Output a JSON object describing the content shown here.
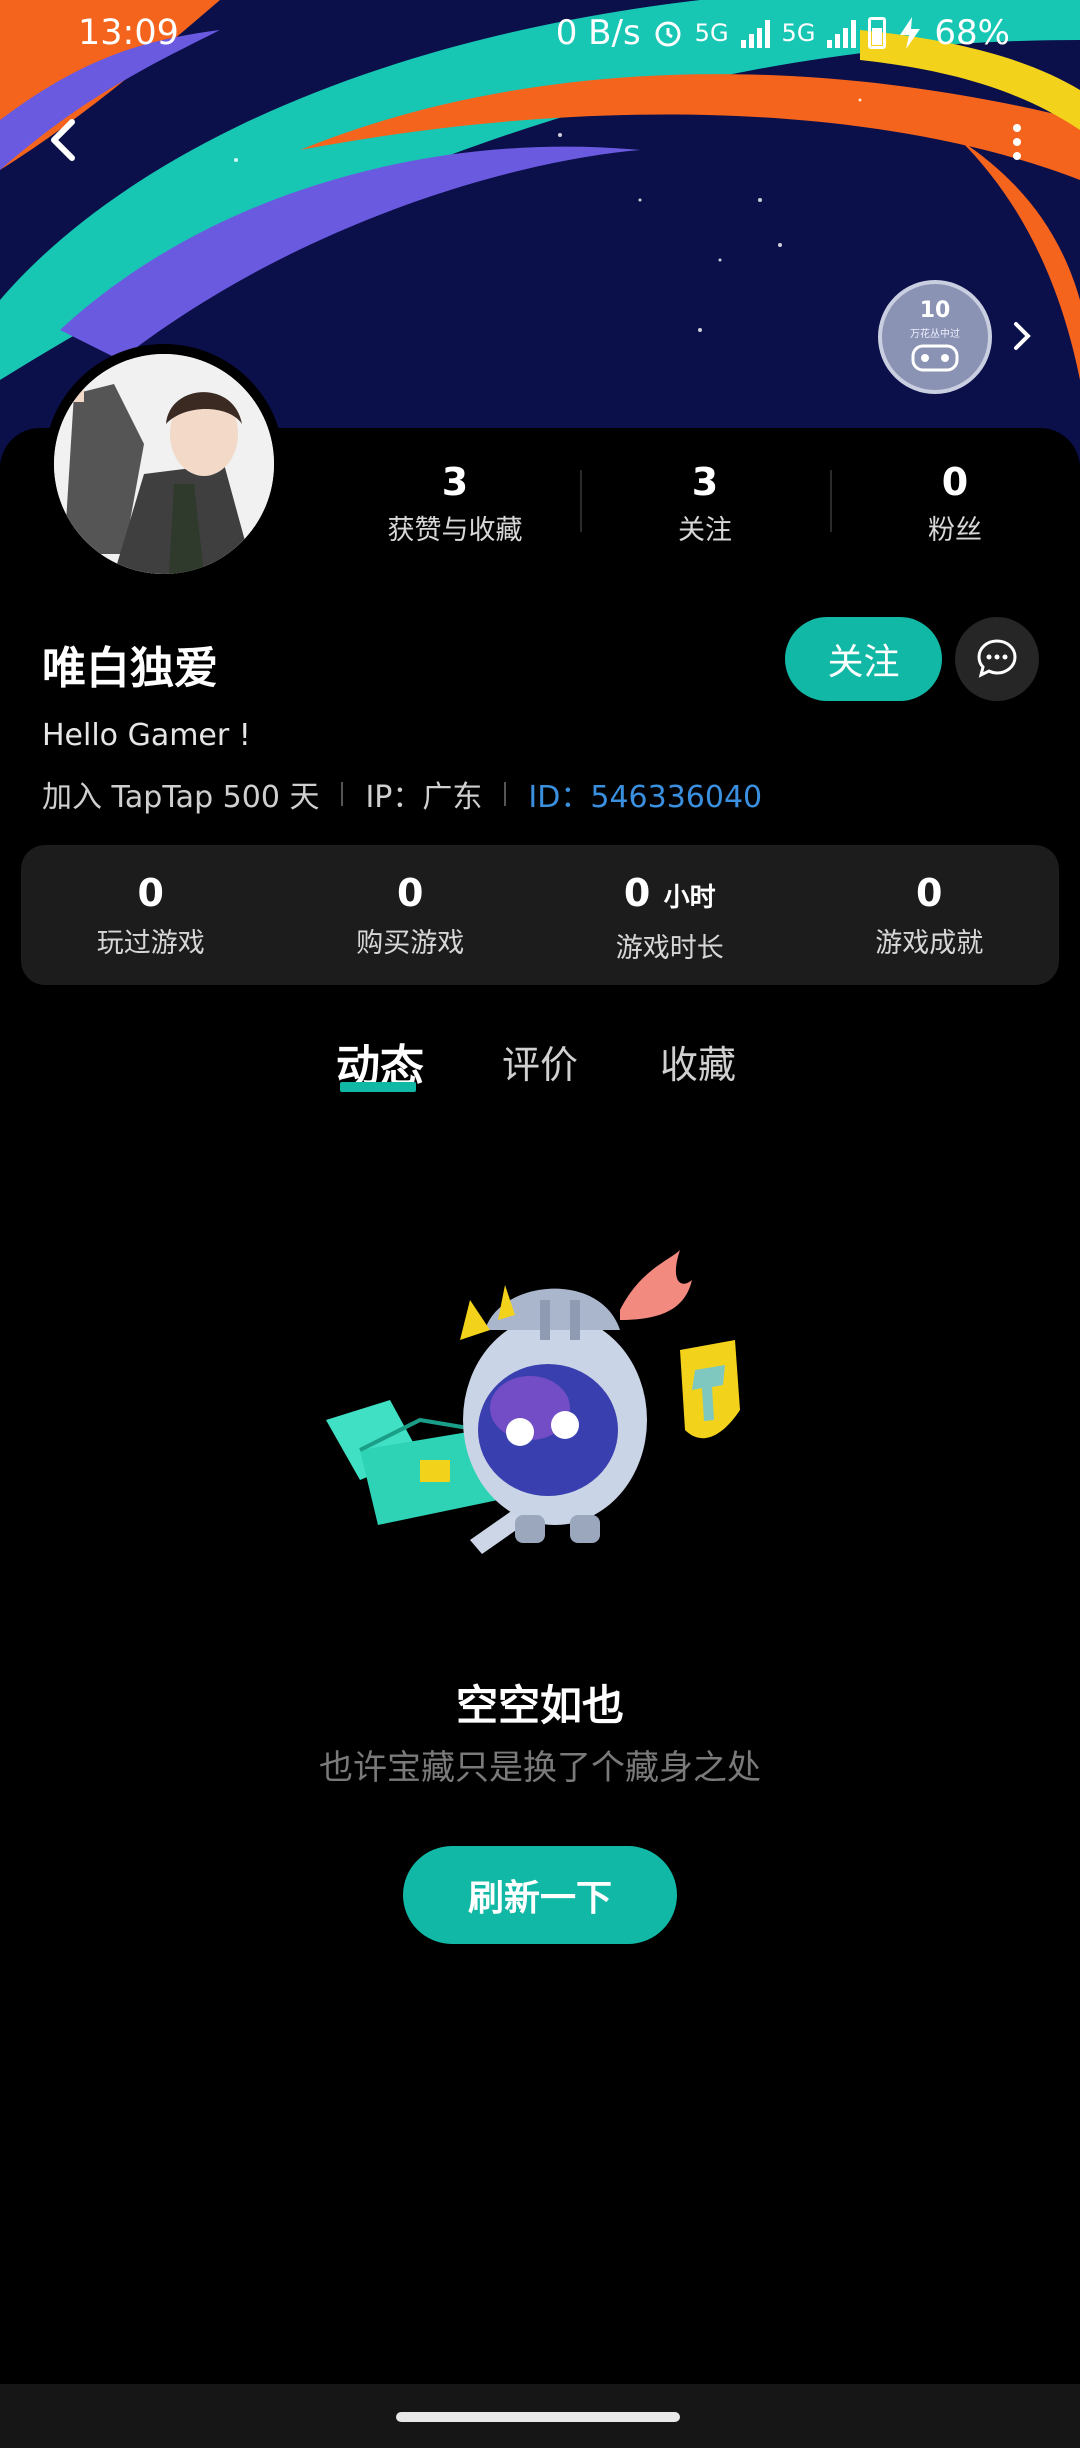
{
  "status_bar": {
    "time": "13:09",
    "net_speed": "0 B/s",
    "sim1": "5G",
    "sim2": "5G",
    "battery": "68%"
  },
  "header": {
    "level": "10",
    "level_sub": "万花丛中过"
  },
  "profile": {
    "stats": [
      {
        "value": "3",
        "label": "获赞与收藏"
      },
      {
        "value": "3",
        "label": "关注"
      },
      {
        "value": "0",
        "label": "粉丝"
      }
    ],
    "username": "唯白独爱",
    "follow_label": "关注",
    "bio": "Hello Gamer !",
    "joined": "加入 TapTap 500 天",
    "ip": "IP：广东",
    "id": "ID：546336040"
  },
  "game_stats": [
    {
      "value": "0",
      "unit": "",
      "label": "玩过游戏"
    },
    {
      "value": "0",
      "unit": "",
      "label": "购买游戏"
    },
    {
      "value": "0",
      "unit": "小时",
      "label": "游戏时长"
    },
    {
      "value": "0",
      "unit": "",
      "label": "游戏成就"
    }
  ],
  "tabs": [
    "动态",
    "评价",
    "收藏"
  ],
  "empty_state": {
    "title": "空空如也",
    "subtitle": "也许宝藏只是换了个藏身之处",
    "refresh_label": "刷新一下"
  },
  "colors": {
    "accent": "#12b8a6",
    "id_link": "#3a8fdf",
    "card_bg": "#1c1c1c"
  }
}
